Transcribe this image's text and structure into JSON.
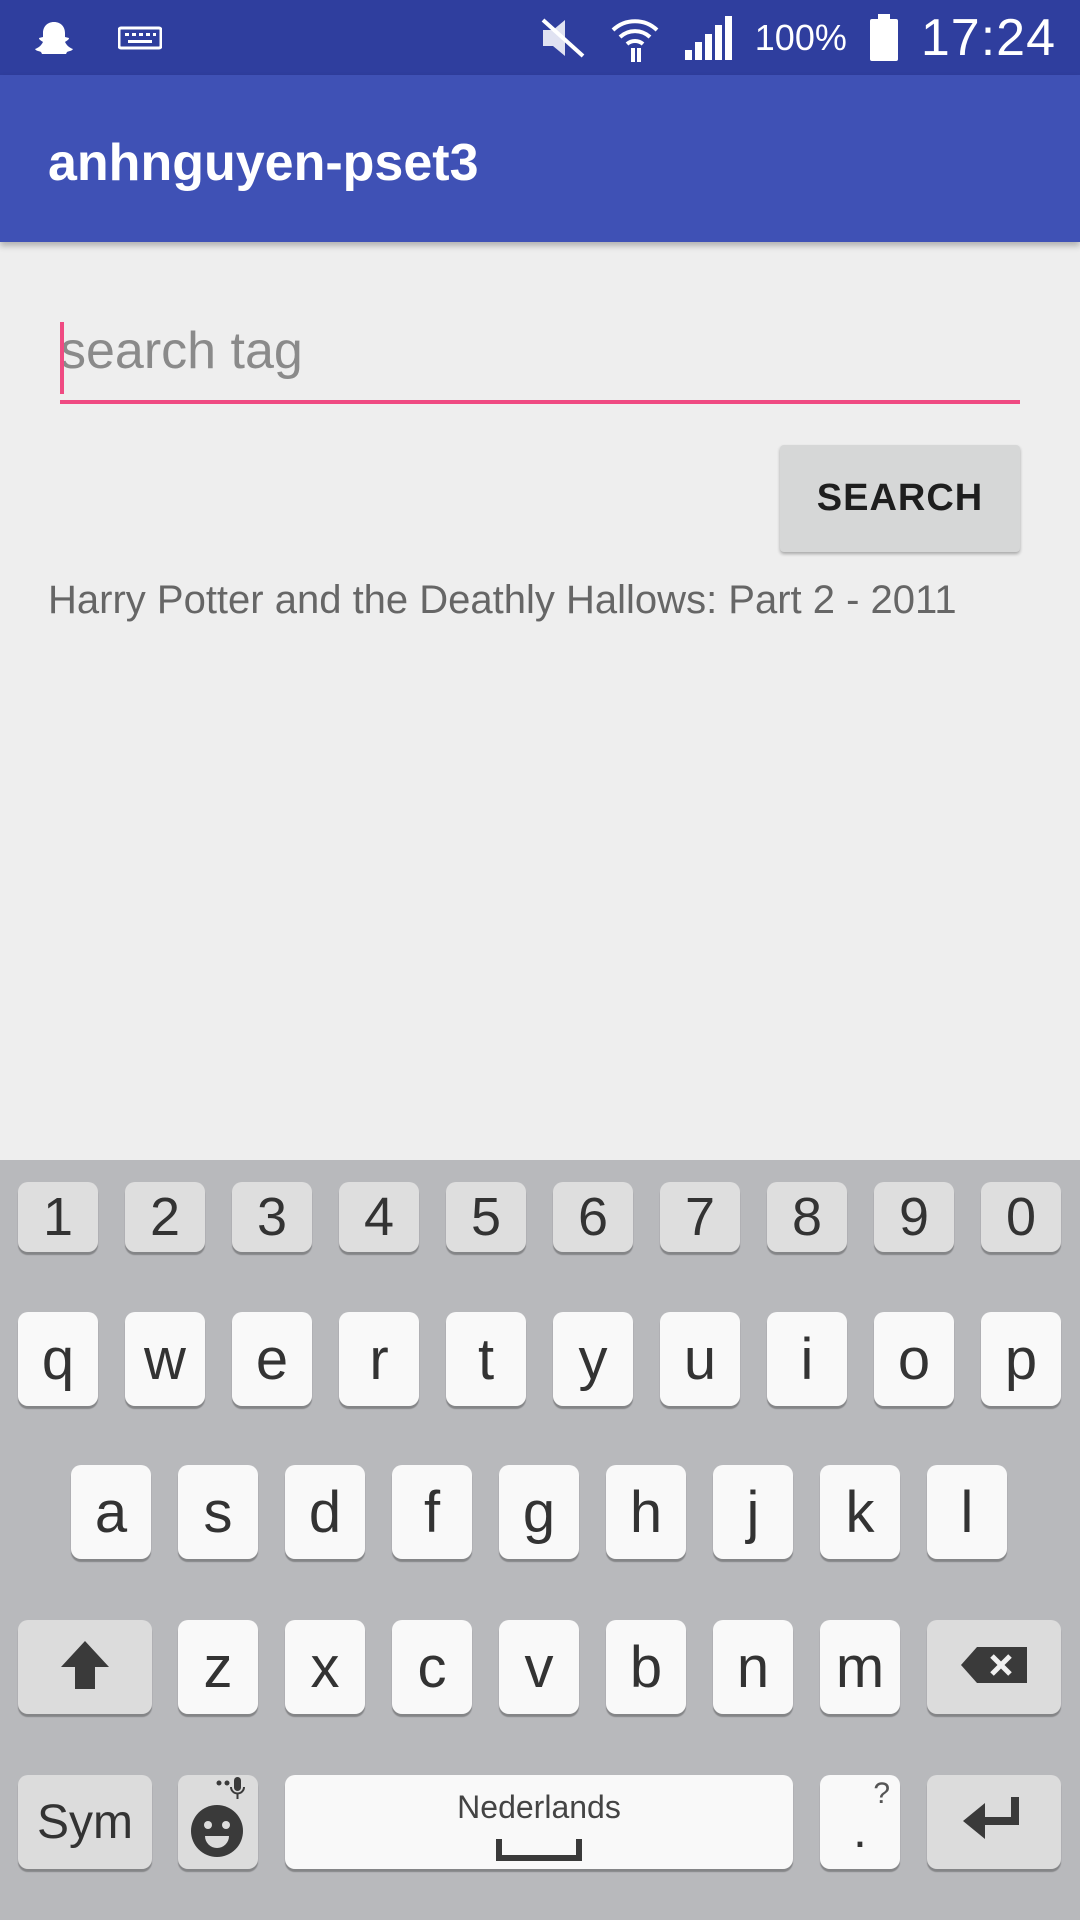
{
  "status_bar": {
    "time": "17:24",
    "battery_percent": "100%",
    "icons": [
      "snapchat-icon",
      "keyboard-icon",
      "mute-icon",
      "wifi-icon",
      "signal-icon",
      "battery-icon"
    ]
  },
  "app_bar": {
    "title": "anhnguyen-pset3"
  },
  "search": {
    "placeholder": "search tag",
    "value": ""
  },
  "search_button": {
    "label": "SEARCH"
  },
  "results": [
    "Harry Potter and the Deathly Hallows: Part 2  -  2011"
  ],
  "keyboard": {
    "number_row": [
      "1",
      "2",
      "3",
      "4",
      "5",
      "6",
      "7",
      "8",
      "9",
      "0"
    ],
    "row1": [
      "q",
      "w",
      "e",
      "r",
      "t",
      "y",
      "u",
      "i",
      "o",
      "p"
    ],
    "row2": [
      "a",
      "s",
      "d",
      "f",
      "g",
      "h",
      "j",
      "k",
      "l"
    ],
    "row3": [
      "z",
      "x",
      "c",
      "v",
      "b",
      "n",
      "m"
    ],
    "sym_label": "Sym",
    "space_label": "Nederlands",
    "period_label": ".",
    "period_hint": "?",
    "colors": {
      "background": "#b8b9bc",
      "key": "#f9f9f9",
      "func_key": "#dcdcdc"
    }
  },
  "colors": {
    "status_bar": "#2f3e9e",
    "app_bar": "#3f51b5",
    "accent": "#ef4a82",
    "background": "#eeeeee"
  }
}
